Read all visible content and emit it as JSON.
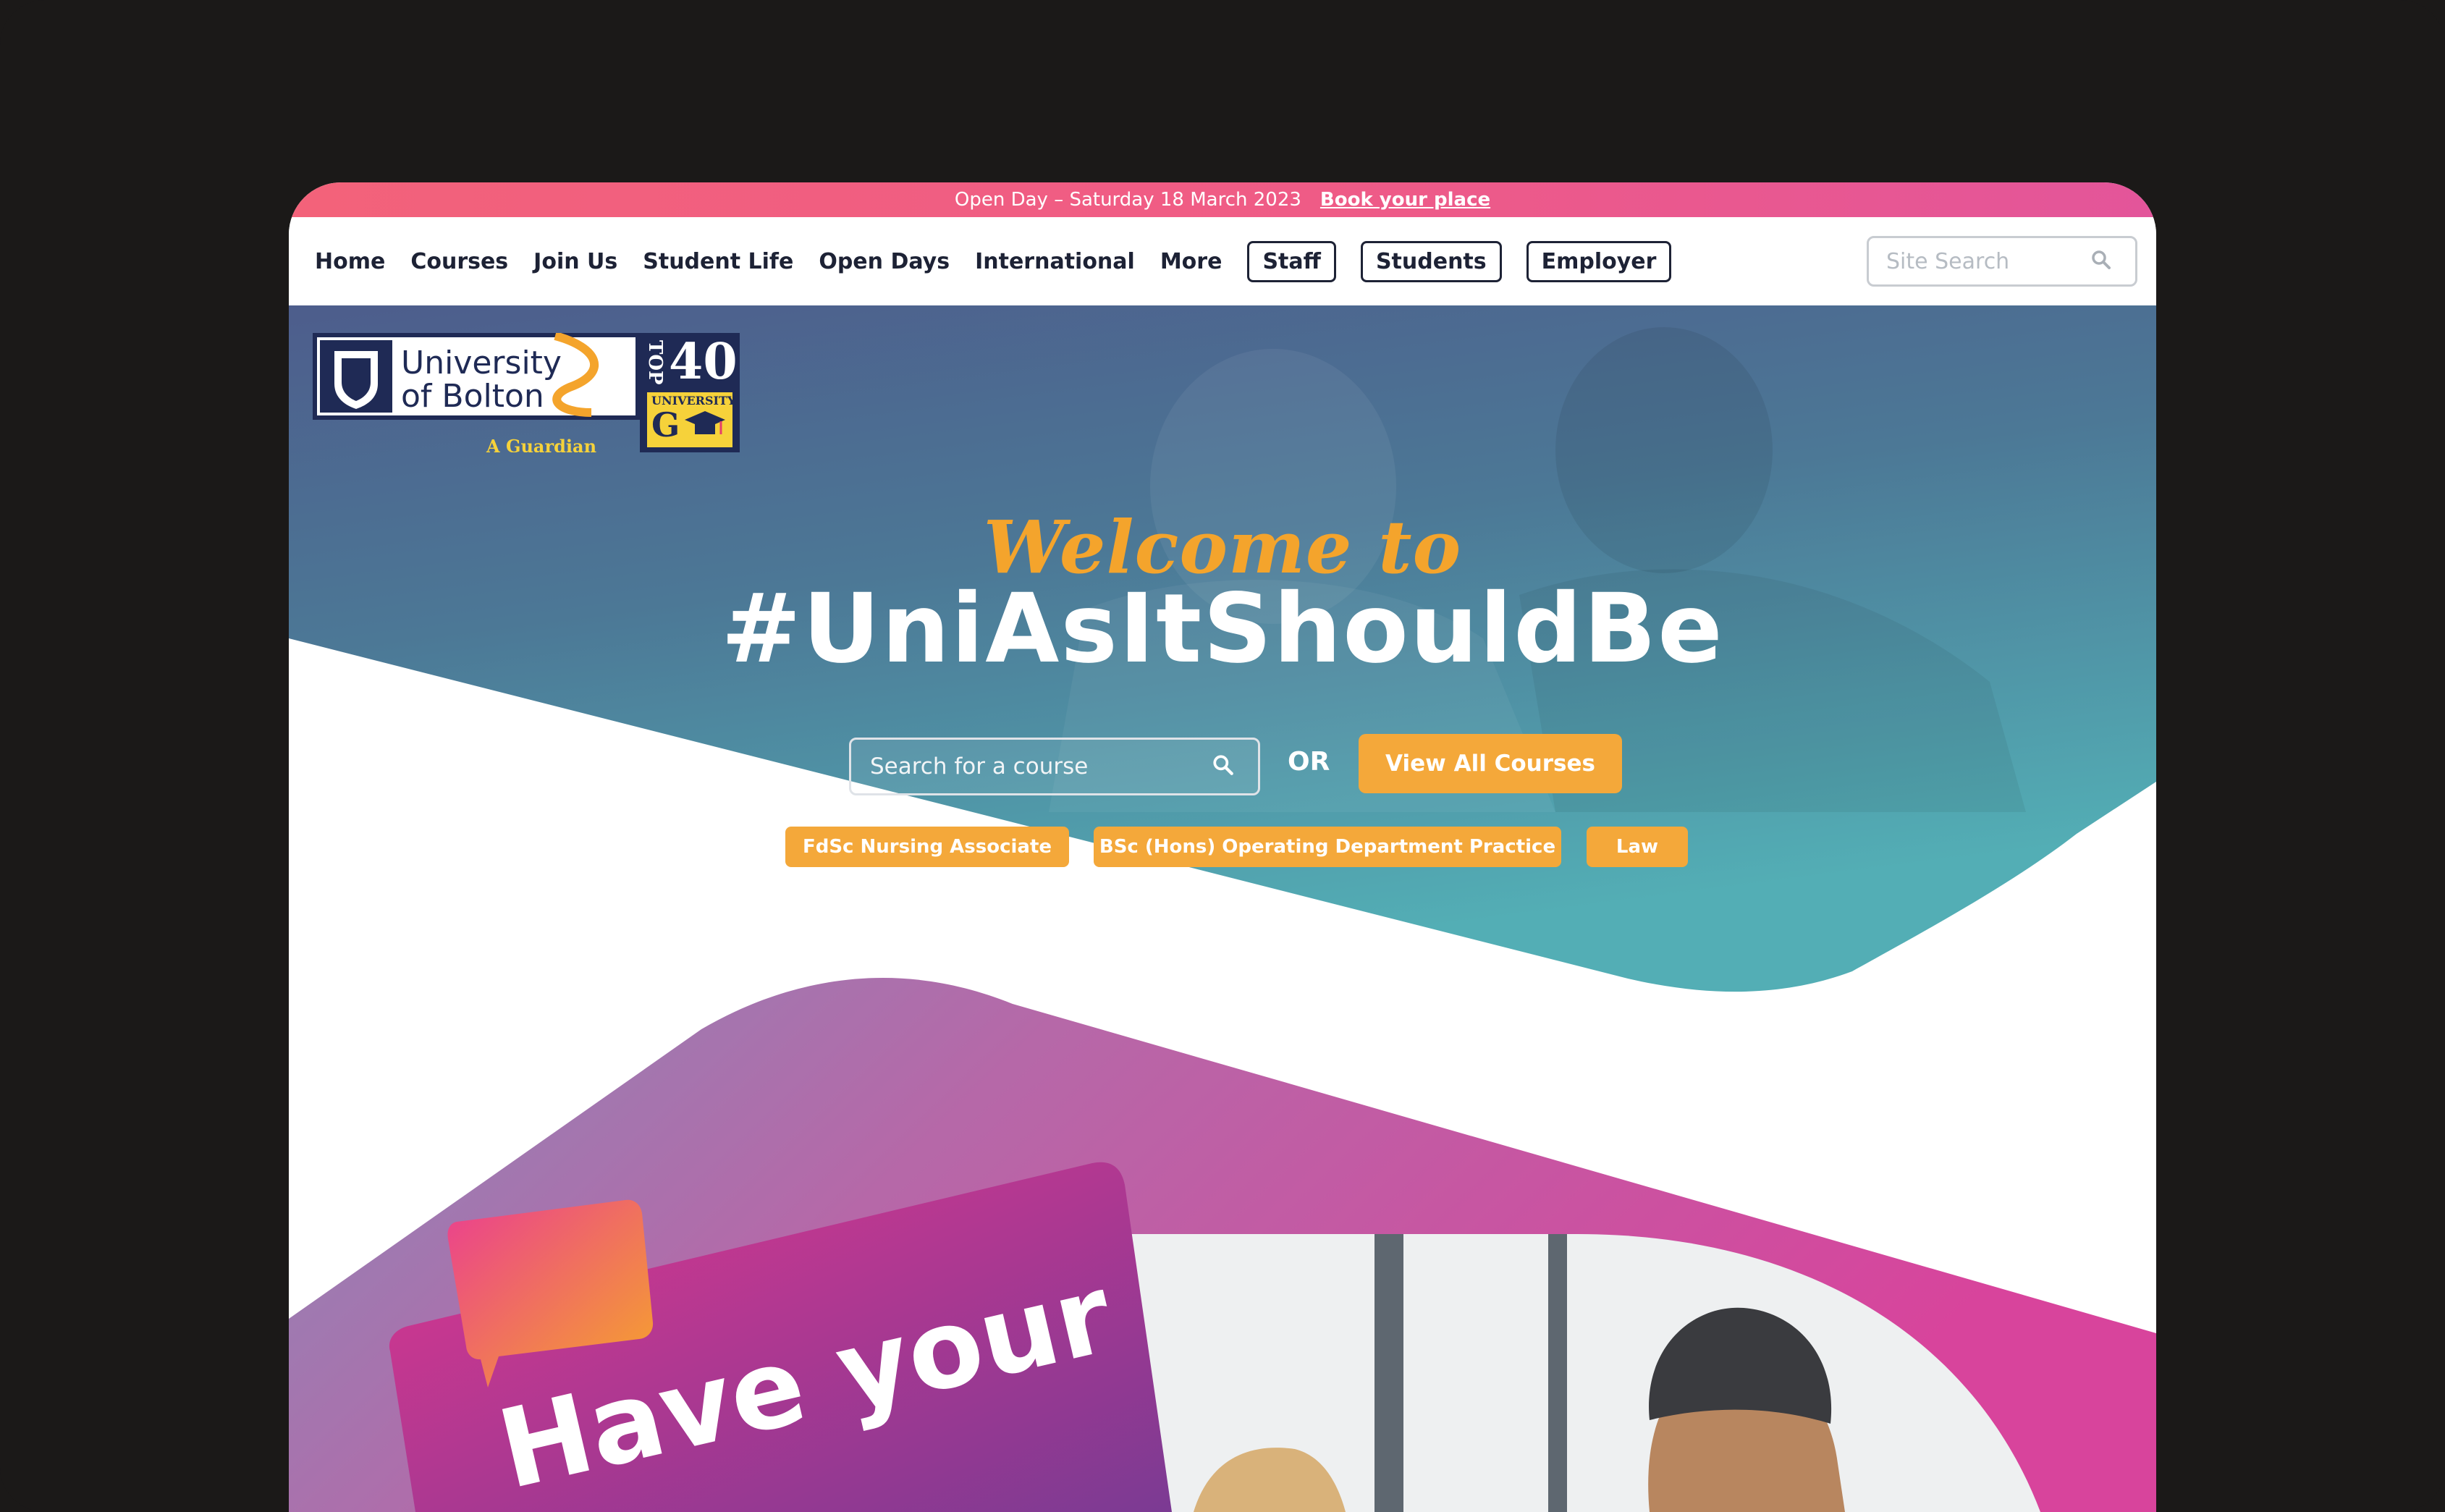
{
  "topbar": {
    "message": "Open Day – Saturday 18 March 2023",
    "link": "Book your place"
  },
  "nav": {
    "items": [
      "Home",
      "Courses",
      "Join Us",
      "Student Life",
      "Open Days",
      "International",
      "More"
    ],
    "buttons": [
      "Staff",
      "Students",
      "Employer"
    ],
    "search_placeholder": "Site Search"
  },
  "logo": {
    "line1": "University",
    "line2": "of Bolton",
    "badge_top": "TOP",
    "badge_number": "40",
    "badge_label": "UNIVERSITY",
    "badge_letter": "G",
    "badge_source": "A Guardian"
  },
  "hero": {
    "welcome": "Welcome to",
    "hashtag": "#UniAsItShouldBe",
    "search_placeholder": "Search for a course",
    "or_label": "OR",
    "view_all_label": "View All Courses",
    "quick_links": [
      "FdSc Nursing Associate",
      "BSc (Hons) Operating Department Practice",
      "Law"
    ]
  },
  "promo": {
    "card_text": "Have your"
  },
  "colors": {
    "accent_orange": "#f4a83a",
    "topbar_pink": "#f3627a",
    "nav_text": "#1d2235",
    "promo_magenta": "#d6459e"
  }
}
